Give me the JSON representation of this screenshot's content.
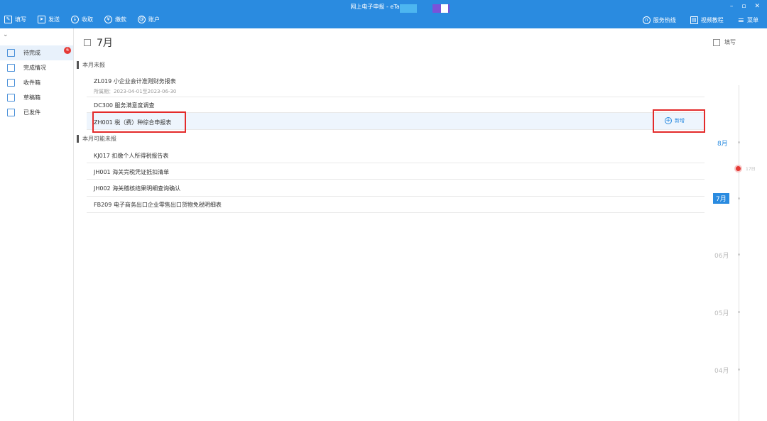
{
  "window": {
    "title": "网上电子申报 - eTax@SH",
    "controls": [
      "–",
      "▫",
      "✕"
    ],
    "swatch_colors": [
      "#4db6f0",
      "#7b52d9",
      "#ffffff"
    ]
  },
  "toolbar": {
    "left": [
      {
        "label": "填写",
        "icon": "edit-icon"
      },
      {
        "label": "发送",
        "icon": "send-icon"
      },
      {
        "label": "收取",
        "icon": "download-icon"
      },
      {
        "label": "缴款",
        "icon": "yen-icon"
      },
      {
        "label": "账户",
        "icon": "user-icon"
      }
    ],
    "right": [
      {
        "label": "服务热线",
        "icon": "headset-icon"
      },
      {
        "label": "视频教程",
        "icon": "video-icon"
      },
      {
        "label": "菜单",
        "icon": "menu-icon"
      }
    ]
  },
  "sidebar": {
    "items": [
      {
        "label": "待完成",
        "icon": "todo-icon",
        "badge": "6"
      },
      {
        "label": "完成情况",
        "icon": "status-icon"
      },
      {
        "label": "收件箱",
        "icon": "inbox-icon"
      },
      {
        "label": "草稿箱",
        "icon": "drafts-icon"
      },
      {
        "label": "已发件",
        "icon": "sent-icon"
      }
    ]
  },
  "main": {
    "month_title": "7月",
    "sections": [
      {
        "title": "本月未报",
        "rows": [
          {
            "code_name": "ZL019 小企业会计准则财务报表",
            "period": "所属期：2023-04-01至2023-06-30"
          },
          {
            "code_name": "DC300 服务满意度调查"
          },
          {
            "code_name": "ZH001 税（费）种综合申报表",
            "action_label": "新增"
          }
        ]
      },
      {
        "title": "本月可能未报",
        "rows": [
          {
            "code_name": "KJ017 扣缴个人所得税报告表"
          },
          {
            "code_name": "JH001 海关完税凭证抵扣清单"
          },
          {
            "code_name": "JH002 海关稽核结果明细查询确认"
          },
          {
            "code_name": "FB209 电子商务出口企业零售出口货物免税明细表"
          }
        ]
      }
    ]
  },
  "timeline": {
    "fill_label": "填写",
    "months": [
      "8月",
      "7月",
      "06月",
      "05月",
      "04月"
    ],
    "current": "7月",
    "today_label": "17日",
    "accent": "#2a8be0",
    "highlight_box_color": "#e32b2b"
  }
}
